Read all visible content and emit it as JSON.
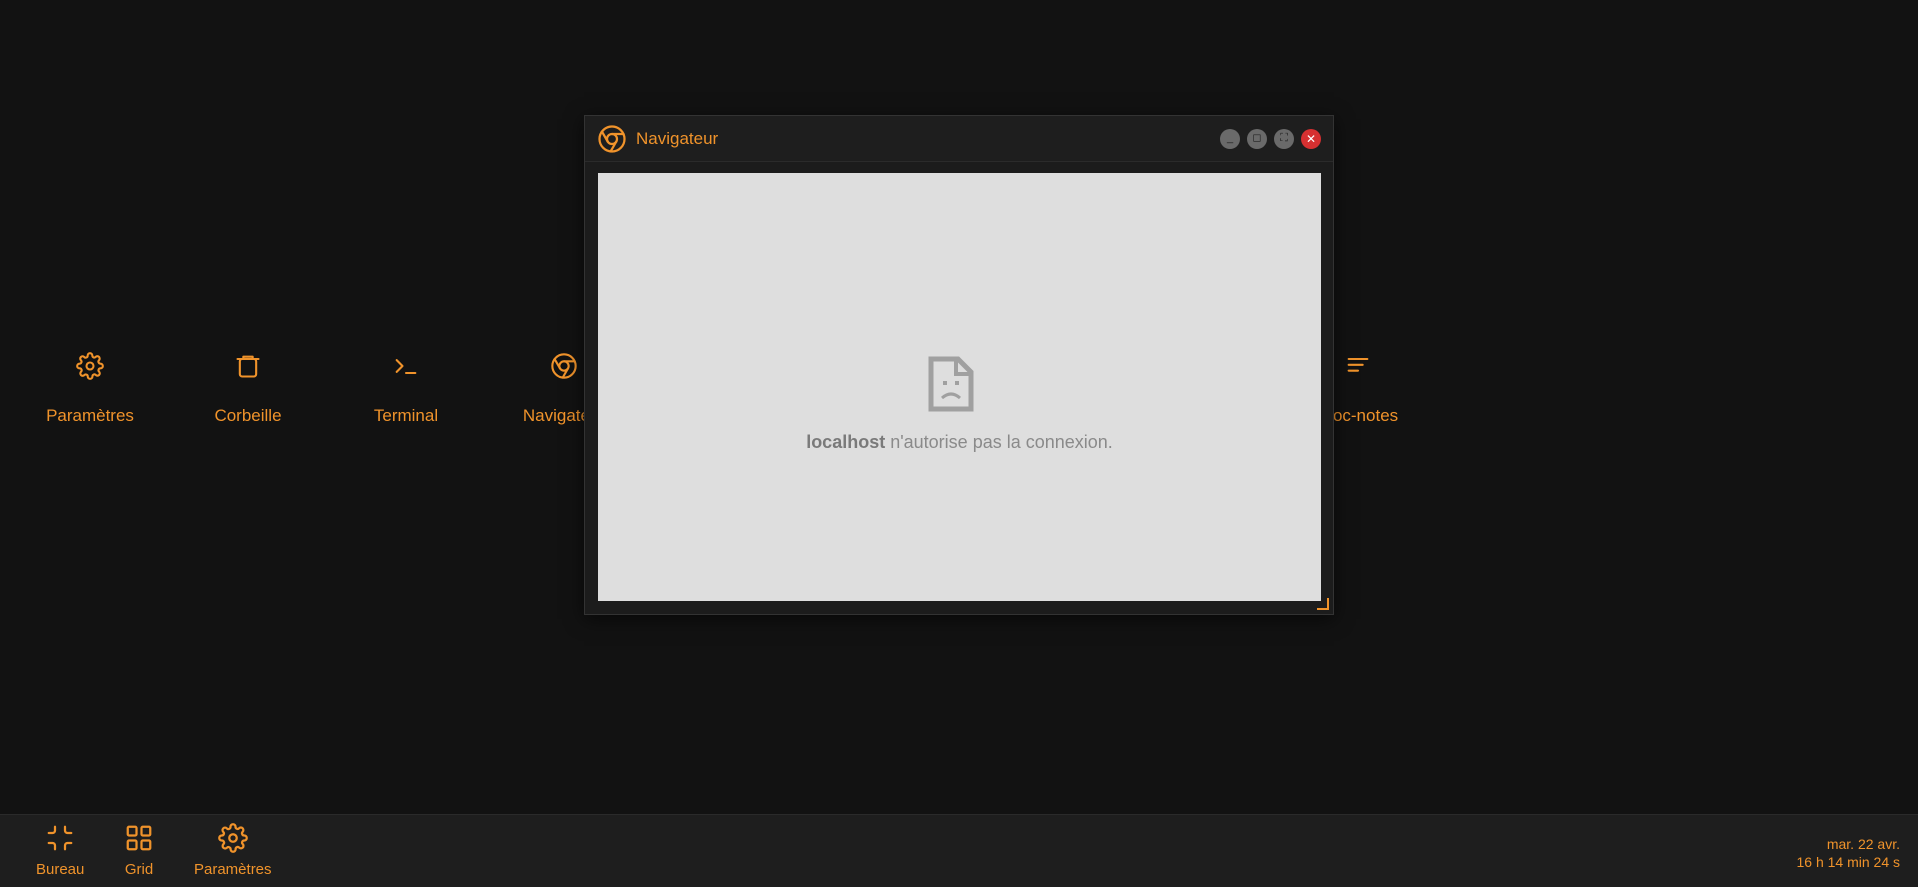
{
  "desktop": {
    "icons": [
      {
        "label": "Paramètres",
        "icon": "gear-icon"
      },
      {
        "label": "Corbeille",
        "icon": "trash-icon"
      },
      {
        "label": "Terminal",
        "icon": "terminal-icon"
      },
      {
        "label": "Navigateur",
        "icon": "browser-icon"
      },
      {
        "label": "Bloc-notes",
        "icon": "notes-icon"
      }
    ]
  },
  "window": {
    "title": "Navigateur",
    "controls": {
      "minimize": "_",
      "restore": "◻",
      "maximize": "⛶",
      "close": "✕"
    },
    "error": {
      "host": "localhost",
      "message": " n'autorise pas la connexion."
    }
  },
  "taskbar": {
    "items": [
      {
        "label": "Bureau",
        "icon": "collapse-icon"
      },
      {
        "label": "Grid",
        "icon": "grid-icon"
      },
      {
        "label": "Paramètres",
        "icon": "gear-icon"
      }
    ],
    "date": "mar. 22 avr.",
    "time": "16 h 14 min 24 s"
  },
  "colors": {
    "accent": "#f0932b",
    "background": "#121212",
    "close": "#d63031"
  }
}
